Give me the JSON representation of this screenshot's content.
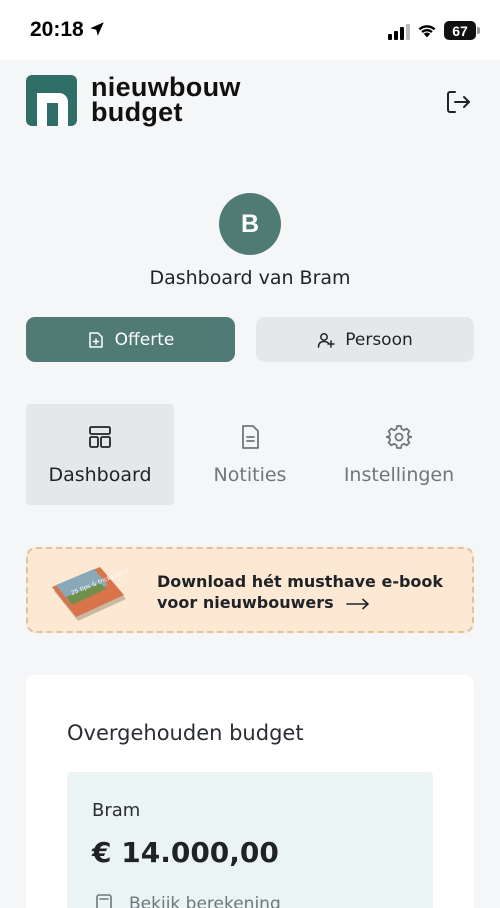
{
  "status": {
    "time": "20:18",
    "battery": "67"
  },
  "brand": {
    "line1": "nieuwbouw",
    "line2": "budget",
    "logo_letter": "n",
    "color": "#2f6f67"
  },
  "profile": {
    "initial": "B",
    "title": "Dashboard van Bram"
  },
  "actions": {
    "primary_label": "Offerte",
    "secondary_label": "Persoon"
  },
  "tabs": [
    {
      "label": "Dashboard",
      "icon": "layout-icon",
      "active": true
    },
    {
      "label": "Notities",
      "icon": "document-icon",
      "active": false
    },
    {
      "label": "Instellingen",
      "icon": "gear-icon",
      "active": false
    }
  ],
  "promo": {
    "line1": "Download hét musthave e-book",
    "line2": "voor nieuwbouwers",
    "book_title": "25 tips & tricks bij nieuwbouw"
  },
  "budget": {
    "title": "Overgehouden budget",
    "name": "Bram",
    "amount": "€ 14.000,00",
    "link_label": "Bekijk berekening"
  },
  "colors": {
    "accent": "#4f7b74",
    "promo_bg": "#fde9d3",
    "card_inner": "#eaf5f3"
  }
}
